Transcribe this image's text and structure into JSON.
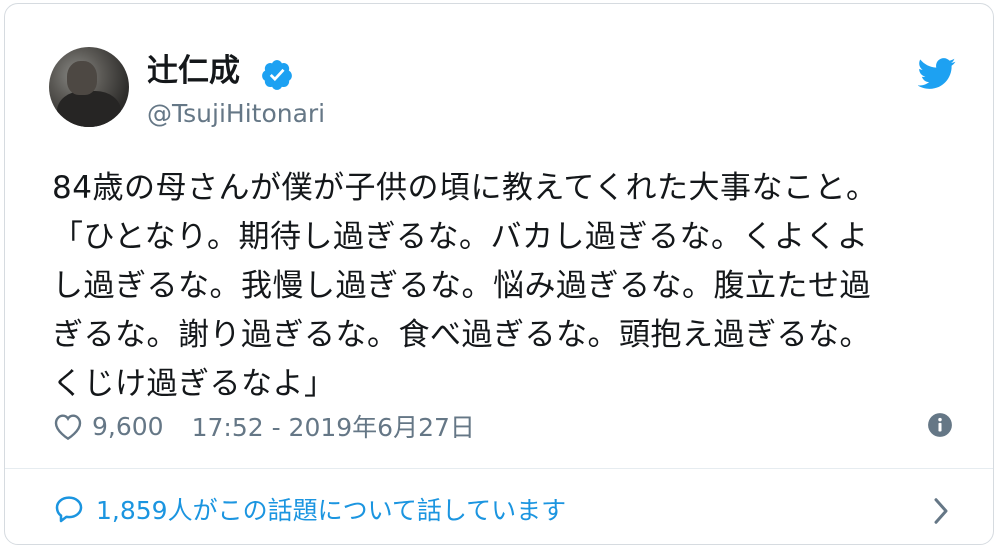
{
  "tweet": {
    "display_name": "辻仁成",
    "handle": "@TsujiHitonari",
    "text": "84歳の母さんが僕が子供の頃に教えてくれた大事なこと。\n「ひとなり。期待し過ぎるな。バカし過ぎるな。くよくよ\nし過ぎるな。我慢し過ぎるな。悩み過ぎるな。腹立たせ過\nぎるな。謝り過ぎるな。食べ過ぎるな。頭抱え過ぎるな。\nくじけ過ぎるなよ」",
    "likes": "9,600",
    "timestamp": "17:52 - 2019年6月27日",
    "conversation": "1,859人がこの話題について話しています"
  },
  "icons": {
    "verified": "verified-badge-icon",
    "brand": "twitter-bird-icon",
    "like": "heart-icon",
    "info": "info-icon",
    "reply": "speech-bubble-icon",
    "more": "chevron-right-icon"
  },
  "colors": {
    "brand_blue": "#1da1f2",
    "link_blue": "#1b95e0",
    "secondary_text": "#657786",
    "primary_text": "#14171a"
  }
}
